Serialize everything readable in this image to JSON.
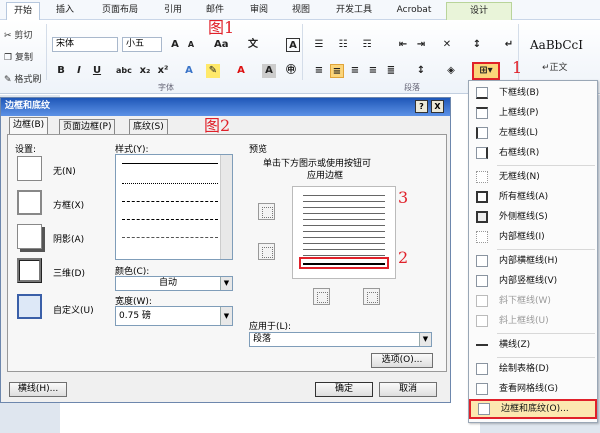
{
  "tabs": [
    "开始",
    "插入",
    "页面布局",
    "引用",
    "邮件",
    "审阅",
    "视图",
    "开发工具",
    "Acrobat",
    "设计"
  ],
  "ribbon": {
    "clipboard": [
      "剪切",
      "复制",
      "格式刷"
    ],
    "font_name": "宋体",
    "font_size": "小五",
    "style_sample": "AaBbCcI",
    "style_name": "↵正文",
    "group_font": "字体",
    "group_para": "段落",
    "bold": "B",
    "italic": "I",
    "underline": "U"
  },
  "annotations": {
    "a1": "图1",
    "a2": "图2",
    "n1": "1",
    "n2": "2",
    "n3": "3"
  },
  "dialog": {
    "title": "边框和底纹",
    "help": "?",
    "close": "X",
    "tabs": [
      "边框(B)",
      "页面边框(P)",
      "底纹(S)"
    ],
    "setting_label": "设置:",
    "settings": [
      "无(N)",
      "方框(X)",
      "阴影(A)",
      "三维(D)",
      "自定义(U)"
    ],
    "style_label": "样式(Y):",
    "color_label": "颜色(C):",
    "color_value": "自动",
    "width_label": "宽度(W):",
    "width_value": "0.75 磅",
    "preview_label": "预览",
    "preview_hint_1": "单击下方图示或使用按钮可",
    "preview_hint_2": "应用边框",
    "apply_label": "应用于(L):",
    "apply_value": "段落",
    "options_button": "选项(O)...",
    "hline_button": "横线(H)...",
    "ok_button": "确定",
    "cancel_button": "取消"
  },
  "menu": {
    "items": [
      {
        "label": "下框线(B)",
        "disabled": false
      },
      {
        "label": "上框线(P)",
        "disabled": false
      },
      {
        "label": "左框线(L)",
        "disabled": false
      },
      {
        "label": "右框线(R)",
        "disabled": false
      },
      {
        "label": "无框线(N)",
        "disabled": false
      },
      {
        "label": "所有框线(A)",
        "disabled": false
      },
      {
        "label": "外侧框线(S)",
        "disabled": false
      },
      {
        "label": "内部框线(I)",
        "disabled": false
      },
      {
        "label": "内部横框线(H)",
        "disabled": false
      },
      {
        "label": "内部竖框线(V)",
        "disabled": false
      },
      {
        "label": "斜下框线(W)",
        "disabled": true
      },
      {
        "label": "斜上框线(U)",
        "disabled": true
      },
      {
        "label": "横线(Z)",
        "disabled": false
      },
      {
        "label": "绘制表格(D)",
        "disabled": false
      },
      {
        "label": "查看网格线(G)",
        "disabled": false
      },
      {
        "label": "边框和底纹(O)...",
        "disabled": false
      }
    ]
  },
  "colors": {
    "accent_red": "#e0212a",
    "title_blue": "#1f57b8"
  }
}
